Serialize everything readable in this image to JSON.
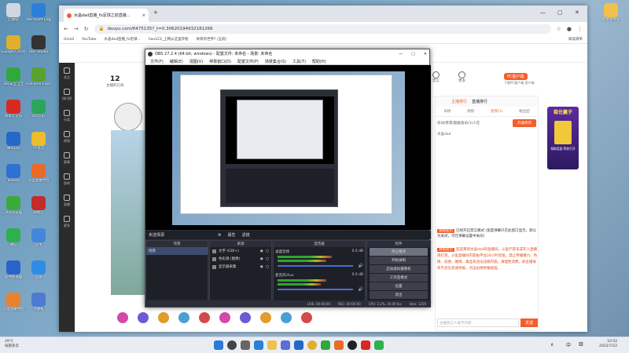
{
  "desktop_icons": [
    {
      "label": "回收站",
      "color": "#cfd8e2"
    },
    {
      "label": "Microsoft Edge",
      "color": "#2b7fd8"
    },
    {
      "label": "Google Chrome",
      "color": "#e0b02c"
    },
    {
      "label": "Obs Studio",
      "color": "#333333"
    },
    {
      "label": "360安全卫士",
      "color": "#31a83a"
    },
    {
      "label": "GeForce Experience",
      "color": "#5aa12f"
    },
    {
      "label": "网易云音乐",
      "color": "#d9281f"
    },
    {
      "label": "QQ音乐",
      "color": "#29a65a"
    },
    {
      "label": "腾讯QQ",
      "color": "#2468c8"
    },
    {
      "label": "YY语音",
      "color": "#ecbd2e"
    },
    {
      "label": "ToDesk",
      "color": "#2f70d3"
    },
    {
      "label": "斗鱼直播伴侣",
      "color": "#ec6a28"
    },
    {
      "label": "360浏览器",
      "color": "#3aaa3a"
    },
    {
      "label": "网易云",
      "color": "#c42c2c"
    },
    {
      "label": "微信",
      "color": "#2db04f"
    },
    {
      "label": "应用",
      "color": "#4287d9"
    },
    {
      "label": "雷神加速器",
      "color": "#2a62c9"
    },
    {
      "label": "迅雷",
      "color": "#2f8ce6"
    },
    {
      "label": "斗鱼直播伴侣",
      "color": "#e8822e"
    },
    {
      "label": "计算机",
      "color": "#4c7bd1"
    }
  ],
  "browser": {
    "tab_title": "水晶dad直播_fo足球之前直播...",
    "url": "douyu.com/6475135?_t=0.30620194932181266",
    "bookmarks": [
      "Gmail",
      "YouTube",
      "水晶dad直播_fo足球...",
      "hao123_上网从这里开始",
      "体育的世界? (五班)"
    ],
    "reading_list": "阅读清单",
    "left_nav": [
      "关注",
      "排行榜",
      "分类",
      "视频",
      "赛事",
      "鱼吧",
      "直播",
      "更多"
    ],
    "stats_num": "12",
    "stats_label": "主播的订阅",
    "pc_client": "PC客户端",
    "pc_client_sub": "下载PC客户端 用户端",
    "mute_label": "禁言",
    "more_label": "更多",
    "rank_tabs": [
      "主播排行",
      "直播排行"
    ],
    "sub_tabs": [
      "日榜",
      "周榜",
      "贵宾(1)",
      "粉丝团"
    ],
    "fan_text": "房间/贵宾/超级会员(1)人在",
    "open_btn": "开通贵宾",
    "viewer": "水晶dad",
    "chat1_tag": "系统提示",
    "chat1": "已经开启禁言模式 (宽度弹幕只在此窗口显示，默认为关闭，可在弹幕设置中关闭)",
    "chat2_tag": "系统提示",
    "chat2": "欢迎来到水晶dad的直播间。斗鱼严禁未成年人直播或打赏。斗鱼直播间内容由平台24小时巡查。禁止传播暴力、色情、低俗、赌博、毒品等违法违规内容。请理性消费，如主播发布不良信息请举报，点击右侧举报按钮。",
    "chat_input_placeholder": "主播禁言人观不内容",
    "send_btn": "发送",
    "side_banner": "稳住赢子",
    "side_banner_sub": "领取奖励 等你打开"
  },
  "obs": {
    "title": "OBS 27.2.4 (64-bit, windows) - 配置文件: 未命名 - 场景: 未命名",
    "menu": [
      "文件(F)",
      "编辑(E)",
      "视图(V)",
      "停靠窗口(D)",
      "配置文件(P)",
      "场景集合(S)",
      "工具(T)",
      "帮助(H)"
    ],
    "scene_bar": "未选择源",
    "scene_props": "属性",
    "scene_filters": "滤镜",
    "scenes_header": "场景",
    "scene_item": "场景",
    "sources_header": "来源",
    "sources": [
      "文字 (GDI+)",
      "色彩源 (图像)",
      "显示器采集"
    ],
    "mixer_header": "混音器",
    "mixer_tracks": [
      {
        "name": "桌面音频",
        "db": "0.0 dB",
        "level": 0.62
      },
      {
        "name": "麦克风/Aux",
        "db": "0.0 dB",
        "level": 0.55
      }
    ],
    "controls_header": "控件",
    "controls": [
      "停止推流",
      "开始录制",
      "启动虚拟摄像机",
      "工作室模式",
      "设置",
      "退出"
    ],
    "status": [
      "LIVE: 00:00:00",
      "REC: 00:00:00",
      "CPU: 2.2%, 30.00 fps",
      "kb/s: 1256"
    ]
  },
  "taskbar": {
    "weather_temp": "29°C",
    "weather_desc": "局部多云",
    "time": "10:52",
    "date": "2022/7/22",
    "lang": "中"
  }
}
